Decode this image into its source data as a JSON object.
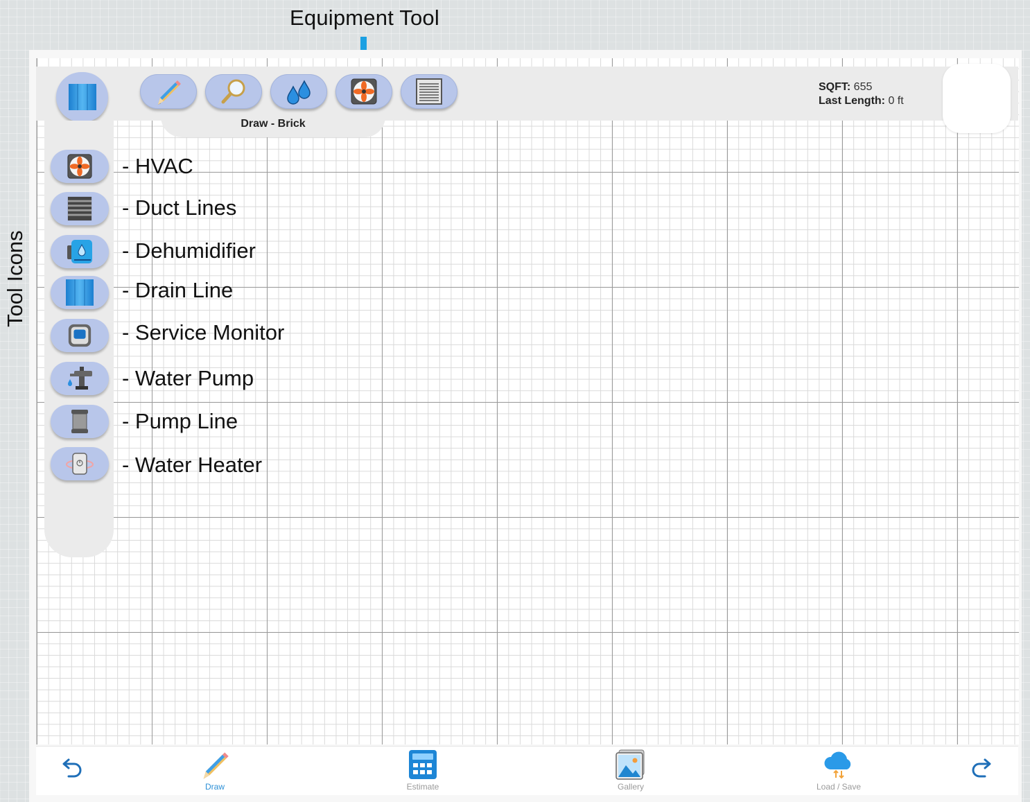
{
  "callouts": {
    "equipment_tool": "Equipment Tool",
    "tool_icons": "Tool Icons"
  },
  "toolbar": {
    "buttons": [
      {
        "name": "pencil-icon"
      },
      {
        "name": "magnifier-icon"
      },
      {
        "name": "water-drops-icon"
      },
      {
        "name": "hvac-fan-icon"
      },
      {
        "name": "duct-vent-icon"
      }
    ],
    "mode_label": "Draw - Brick"
  },
  "stats": {
    "sqft_label": "SQFT:",
    "sqft_value": "655",
    "last_length_label": "Last Length:",
    "last_length_value": "0 ft"
  },
  "side_tools": [
    {
      "icon": "hvac-fan-icon",
      "label": "- HVAC"
    },
    {
      "icon": "duct-lines-icon",
      "label": "- Duct Lines"
    },
    {
      "icon": "dehumidifier-icon",
      "label": "- Dehumidifier"
    },
    {
      "icon": "drain-line-icon",
      "label": "- Drain Line"
    },
    {
      "icon": "service-monitor-icon",
      "label": "- Service Monitor"
    },
    {
      "icon": "water-pump-icon",
      "label": "- Water Pump"
    },
    {
      "icon": "pump-line-icon",
      "label": "- Pump Line"
    },
    {
      "icon": "water-heater-icon",
      "label": "- Water Heater"
    }
  ],
  "bottom_nav": {
    "draw": "Draw",
    "estimate": "Estimate",
    "gallery": "Gallery",
    "load_save": "Load / Save"
  },
  "colors": {
    "accent": "#1ba0e2",
    "button_fill": "#b8c6ea",
    "active_nav": "#2b8fd6"
  }
}
